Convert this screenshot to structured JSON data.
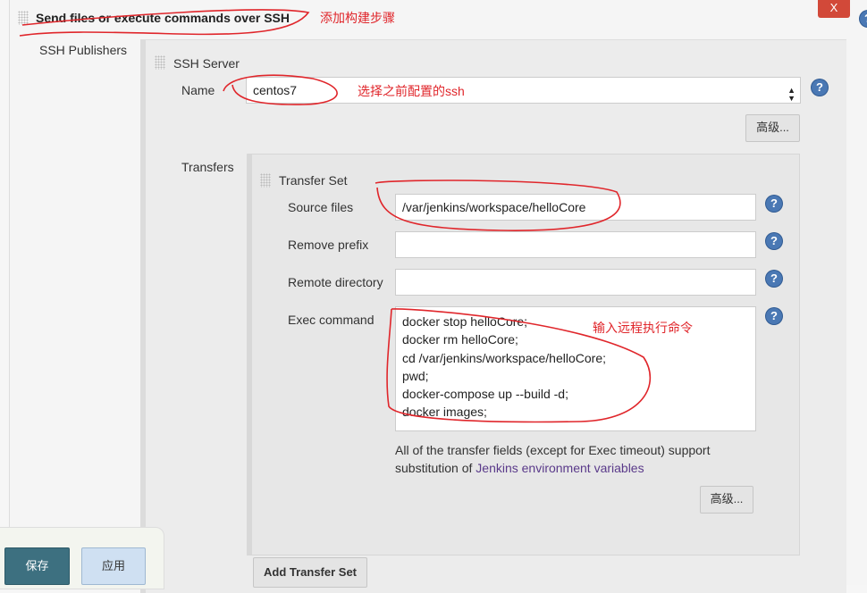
{
  "header": {
    "title": "Send files or execute commands over SSH",
    "close_label": "X"
  },
  "section_label": "SSH Publishers",
  "ssh_server": {
    "title": "SSH Server",
    "name_label": "Name",
    "name_value": "centos7",
    "advanced_label": "高级..."
  },
  "transfers": {
    "label": "Transfers",
    "set_title": "Transfer Set",
    "source_files_label": "Source files",
    "source_files_value": "/var/jenkins/workspace/helloCore",
    "remove_prefix_label": "Remove prefix",
    "remove_prefix_value": "",
    "remote_directory_label": "Remote directory",
    "remote_directory_value": "",
    "exec_command_label": "Exec command",
    "exec_command_value": "docker stop helloCore;\ndocker rm helloCore;\ncd /var/jenkins/workspace/helloCore;\npwd;\ndocker-compose up --build -d;\ndocker images;",
    "help_text": "All of the transfer fields (except for Exec timeout) support",
    "help_text2": "substitution of ",
    "help_link": "Jenkins environment variables",
    "advanced_label": "高级...",
    "add_label": "Add Transfer Set"
  },
  "footer": {
    "save_label": "保存",
    "apply_label": "应用"
  },
  "annotations": {
    "a1": "添加构建步骤",
    "a2": "选择之前配置的ssh",
    "a3": "输入远程执行命令"
  },
  "help_icon": "?",
  "colors": {
    "annotation": "#e0262b",
    "save": "#3d7080",
    "apply": "#cfe0f2",
    "close": "#d24939"
  }
}
